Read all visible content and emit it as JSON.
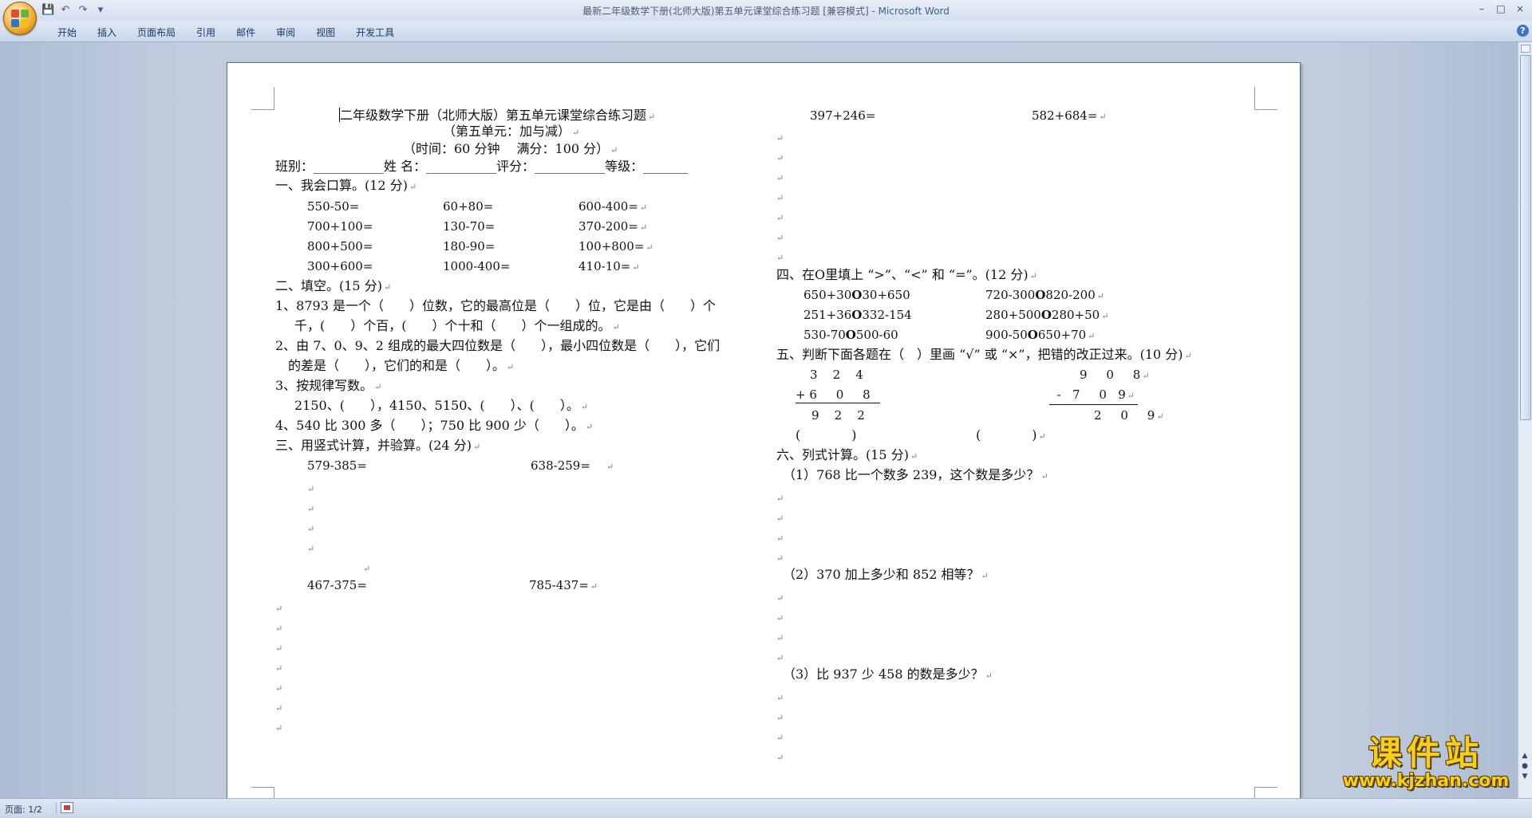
{
  "window": {
    "title": "最新二年级数学下册(北师大版)第五单元课堂综合练习题 [兼容模式] - ",
    "app": "Microsoft Word",
    "controls": [
      "–",
      "□",
      "×"
    ]
  },
  "qat": [
    "save-icon",
    "undo-icon",
    "redo-icon",
    "customize-icon"
  ],
  "qat_glyphs": {
    "save": "💾",
    "undo": "↶",
    "redo": "↷",
    "customize": "▾"
  },
  "tabs": [
    "开始",
    "插入",
    "页面布局",
    "引用",
    "邮件",
    "审阅",
    "视图",
    "开发工具"
  ],
  "status": {
    "page": "页面: 1/2"
  },
  "help": "?",
  "doc": {
    "title": "二年级数学下册（北师大版）第五单元课堂综合练习题",
    "subtitle": "（第五单元：加与减）",
    "time_line": "（时间：60 分钟　 满分：100 分）",
    "info_line": "班别：___________姓 名：___________评分：___________等级：_______",
    "s1_head": "一、我会口算。(12 分)",
    "s1_items": [
      [
        "550-50=",
        "60+80=",
        "600-400="
      ],
      [
        "700+100=",
        "130-70=",
        "370-200="
      ],
      [
        "800+500=",
        "180-90=",
        "100+800="
      ],
      [
        "300+600=",
        "1000-400=",
        "410-10="
      ]
    ],
    "s2_head": "二、填空。(15 分)",
    "q1a": "1、8793 是一个（　　）位数，它的最高位是（　　）位，它是由（　　）个",
    "q1b": "千，(　　）个百，(　　）个十和（　　）个一组成的。",
    "q2a": "2、由 7、0、9、2 组成的最大四位数是（　　），最小四位数是（　　），它们",
    "q2b": "的差是（　　），它们的和是（　　）。",
    "q3": "3、按规律写数。",
    "q3b": "2150、(　　），4150、5150、(　　）、(　　）。",
    "q4": "4、540 比 300 多（　　）；750 比 900 少（　　）。",
    "s3_head": "三、用竖式计算，并验算。(24 分)",
    "s3_items": [
      "579-385=",
      "638-259=",
      "467-375=",
      "785-437=",
      "397+246=",
      "582+684="
    ],
    "s4_head": "四、在O里填上 “>”、“<” 和 “=”。(12 分)",
    "s4_items": [
      [
        "650+30",
        "30+650",
        "720-300",
        "820-200"
      ],
      [
        "251+36",
        "332-154",
        "280+500",
        "280+50"
      ],
      [
        "530-70",
        "500-60",
        "900-50",
        "650+70"
      ]
    ],
    "circle": "O",
    "s5_head": "五、判断下面各题在（　）里画 “√” 或 “×”，把错的改正过来。(10 分)",
    "s5_left": {
      "r1": [
        "3",
        "2",
        "4"
      ],
      "op": "+",
      "r2": [
        "6",
        "0",
        "8"
      ],
      "r3": [
        "9",
        "2",
        "2"
      ],
      "ans": "(　　　　)"
    },
    "s5_right": {
      "r1": [
        "9",
        "0",
        "8"
      ],
      "op": "-",
      "r2": [
        "7",
        "0",
        "9"
      ],
      "r3": [
        "2",
        "0",
        "9"
      ],
      "ans": "(　　　　)"
    },
    "s6_head": "六、列式计算。(15 分)",
    "s6_q1": "（1）768 比一个数多 239，这个数是多少？",
    "s6_q2": "（2）370 加上多少和 852 相等？",
    "s6_q3": "（3）比 937 少 458 的数是多少？",
    "pm": "↵"
  },
  "watermark": {
    "text": "课件站",
    "url": "www.kjzhan.com"
  }
}
